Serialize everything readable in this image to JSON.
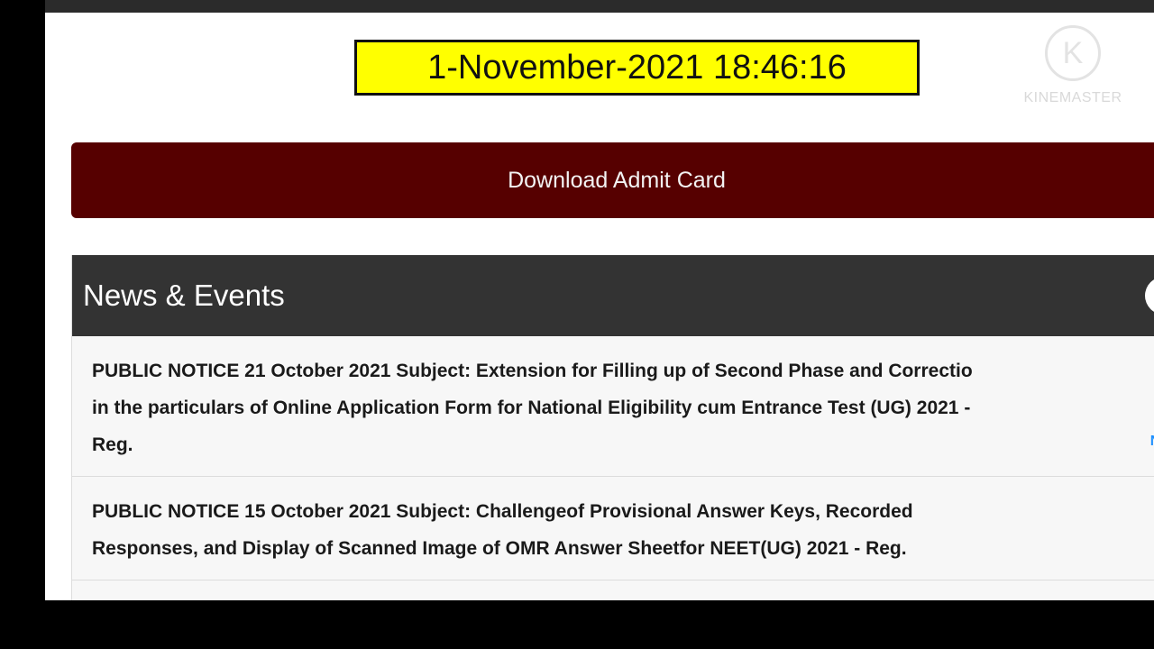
{
  "clock": {
    "text": "1-November-2021 18:46:16"
  },
  "admit_card": {
    "label": "Download Admit Card"
  },
  "news": {
    "title": "News & Events",
    "items": [
      {
        "lines": [
          "PUBLIC NOTICE 21 October 2021 Subject: Extension for Filling up of Second Phase and Correctio",
          "in the particulars of Online Application Form for National Eligibility cum Entrance Test (UG) 2021 -",
          "Reg."
        ],
        "tag": "NE"
      },
      {
        "lines": [
          "PUBLIC NOTICE 15 October 2021 Subject: Challengeof Provisional Answer Keys, Recorded",
          "Responses, and Display of Scanned Image of OMR Answer Sheetfor NEET(UG) 2021 - Reg."
        ]
      }
    ]
  },
  "watermark": {
    "logo_letter": "K",
    "text": "KINEMASTER"
  }
}
